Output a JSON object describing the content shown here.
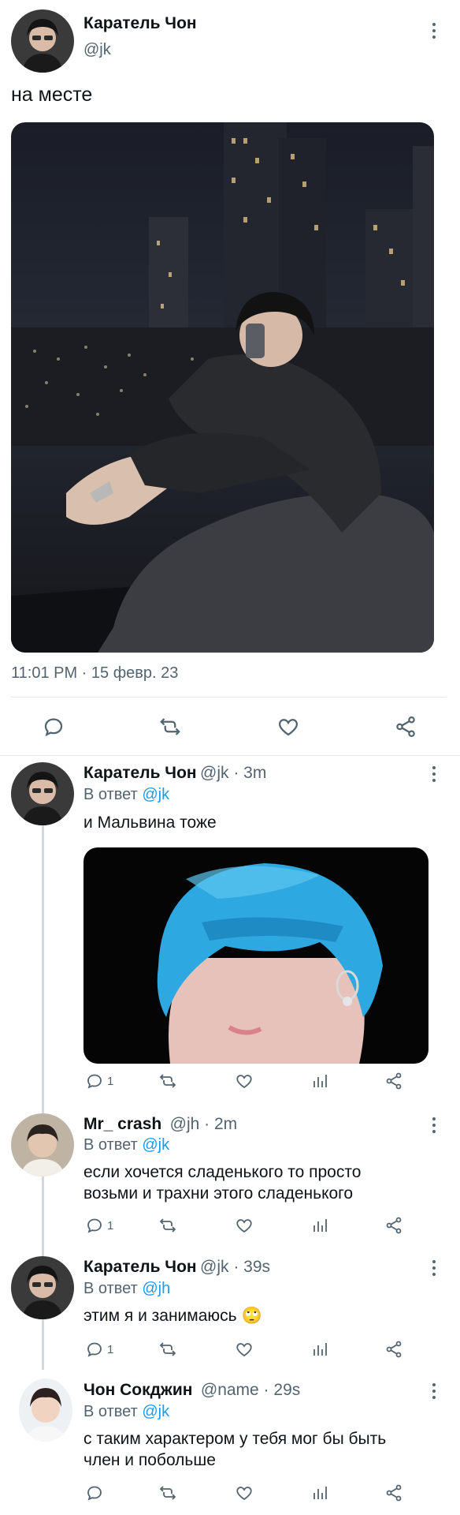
{
  "main_tweet": {
    "name": "Каратель Чон",
    "handle": "@jk",
    "text": "на месте",
    "timestamp": "11:01 PM · 15 февр. 23",
    "actions": [
      "reply-icon",
      "retweet-icon",
      "like-icon",
      "share-icon"
    ]
  },
  "replies": [
    {
      "name": "Каратель Чон",
      "meta": "@jk · 3m",
      "reply_prefix": "В ответ ",
      "reply_to": "@jk",
      "text": "и Мальвина тоже",
      "reply_count": "1",
      "has_image": true
    },
    {
      "name": "Mr_ crash",
      "meta": "@jh · 2m",
      "reply_prefix": "В ответ ",
      "reply_to": "@jk",
      "text_lines": [
        "если хочется сладенького  то просто",
        "возьми и трахни  этого сладенького"
      ],
      "reply_count": "1"
    },
    {
      "name": "Каратель Чон",
      "meta": "@jk · 39s",
      "reply_prefix": "В ответ ",
      "reply_to": "@jh",
      "text": "этим я и занимаюсь",
      "emoji": "🙄",
      "reply_count": "1"
    },
    {
      "name": "Чон Сокджин",
      "meta": "@name · 29s",
      "reply_prefix": "В ответ ",
      "reply_to": "@jk",
      "text_lines": [
        "с таким характером  у тебя мог бы быть",
        "член и побольше"
      ],
      "reply_count": ""
    }
  ],
  "colors": {
    "link": "#1d9bf0",
    "secondary": "#536471",
    "thread": "#cfd9de"
  }
}
